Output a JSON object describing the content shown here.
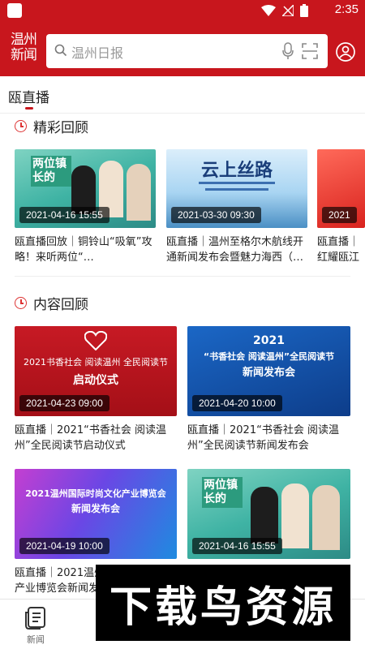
{
  "status_bar": {
    "time": "2:35"
  },
  "header": {
    "logo_line1": "温州",
    "logo_line2": "新闻",
    "search_placeholder": "温州日报"
  },
  "tabs": [
    {
      "label": "瓯直播"
    }
  ],
  "sections": {
    "highlights": {
      "title": "精彩回顾",
      "cards": [
        {
          "date": "2021-04-16 15:55",
          "caption": "瓯直播回放｜铜铃山“吸氧”攻略！来听两位“…",
          "overlay": "两位镇长的"
        },
        {
          "date": "2021-03-30 09:30",
          "caption": "瓯直播｜温州至格尔木航线开通新闻发布会暨魅力海西（…",
          "overlay": "云上丝路"
        },
        {
          "date": "2021",
          "caption": "瓯直播｜红耀瓯江",
          "overlay": ""
        }
      ]
    },
    "content": {
      "title": "内容回顾",
      "cards": [
        {
          "date": "2021-04-23 09:00",
          "caption": "瓯直播｜2021“书香社会 阅读温州”全民阅读节启动仪式",
          "overlay1": "2021书香社会  阅读温州  全民阅读节",
          "overlay2": "启动仪式"
        },
        {
          "date": "2021-04-20 10:00",
          "caption": "瓯直播｜2021“书香社会 阅读温州”全民阅读节新闻发布会",
          "overlay1": "2021",
          "overlay2": "“书香社会 阅读温州”全民阅读节",
          "overlay3": "新闻发布会"
        },
        {
          "date": "2021-04-19 10:00",
          "caption": "瓯直播｜2021温州国际时尚文化产业博览会新闻发",
          "overlay1": "2021温州国际时尚文化产业博览会",
          "overlay2": "新闻发布会"
        },
        {
          "date": "2021-04-16 15:55",
          "caption": "",
          "overlay1": "两位镇长的"
        }
      ]
    }
  },
  "bottom_nav": {
    "news_label": "新闻"
  },
  "watermark": "下载鸟资源",
  "colors": {
    "brand": "#c8161d"
  }
}
